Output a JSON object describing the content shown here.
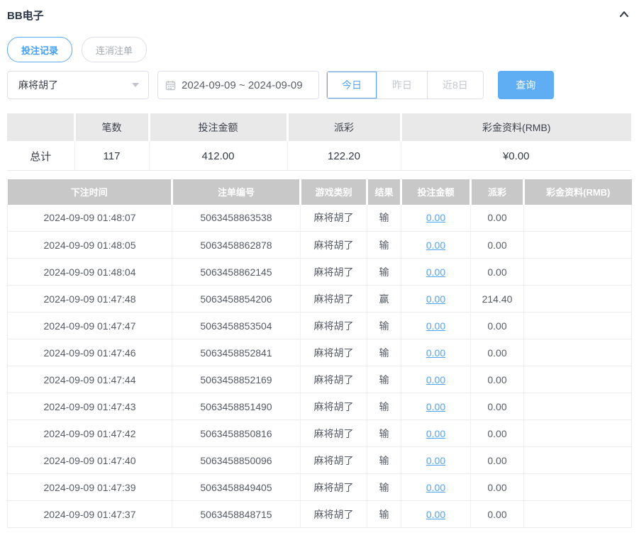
{
  "page": {
    "title": "BB电子"
  },
  "tabs": [
    {
      "label": "投注记录",
      "active": true
    },
    {
      "label": "连消注单",
      "active": false
    }
  ],
  "filters": {
    "game_select_value": "麻将胡了",
    "date_range": "2024-09-09 ~ 2024-09-09",
    "quick_buttons": [
      {
        "label": "今日",
        "active": true
      },
      {
        "label": "昨日",
        "active": false
      },
      {
        "label": "近8日",
        "active": false
      }
    ],
    "query_label": "查询"
  },
  "summary_table": {
    "headers": [
      "",
      "笔数",
      "投注金额",
      "派彩",
      "彩金资料(RMB)"
    ],
    "total_row": {
      "label": "总计",
      "count": "117",
      "bet_amount": "412.00",
      "payout": "122.20",
      "bonus": "¥0.00"
    }
  },
  "records_table": {
    "headers": [
      "下注时间",
      "注单编号",
      "游戏类别",
      "结果",
      "投注金额",
      "派彩",
      "彩金资料(RMB)"
    ],
    "rows": [
      {
        "time": "2024-09-09 01:48:07",
        "bet_no": "5063458863538",
        "game": "麻将胡了",
        "result": "输",
        "bet_amount": "0.00",
        "payout": "0.00",
        "bonus": ""
      },
      {
        "time": "2024-09-09 01:48:05",
        "bet_no": "5063458862878",
        "game": "麻将胡了",
        "result": "输",
        "bet_amount": "0.00",
        "payout": "0.00",
        "bonus": ""
      },
      {
        "time": "2024-09-09 01:48:04",
        "bet_no": "5063458862145",
        "game": "麻将胡了",
        "result": "输",
        "bet_amount": "0.00",
        "payout": "0.00",
        "bonus": ""
      },
      {
        "time": "2024-09-09 01:47:48",
        "bet_no": "5063458854206",
        "game": "麻将胡了",
        "result": "赢",
        "bet_amount": "0.00",
        "payout": "214.40",
        "bonus": ""
      },
      {
        "time": "2024-09-09 01:47:47",
        "bet_no": "5063458853504",
        "game": "麻将胡了",
        "result": "输",
        "bet_amount": "0.00",
        "payout": "0.00",
        "bonus": ""
      },
      {
        "time": "2024-09-09 01:47:46",
        "bet_no": "5063458852841",
        "game": "麻将胡了",
        "result": "输",
        "bet_amount": "0.00",
        "payout": "0.00",
        "bonus": ""
      },
      {
        "time": "2024-09-09 01:47:44",
        "bet_no": "5063458852169",
        "game": "麻将胡了",
        "result": "输",
        "bet_amount": "0.00",
        "payout": "0.00",
        "bonus": ""
      },
      {
        "time": "2024-09-09 01:47:43",
        "bet_no": "5063458851490",
        "game": "麻将胡了",
        "result": "输",
        "bet_amount": "0.00",
        "payout": "0.00",
        "bonus": ""
      },
      {
        "time": "2024-09-09 01:47:42",
        "bet_no": "5063458850816",
        "game": "麻将胡了",
        "result": "输",
        "bet_amount": "0.00",
        "payout": "0.00",
        "bonus": ""
      },
      {
        "time": "2024-09-09 01:47:40",
        "bet_no": "5063458850096",
        "game": "麻将胡了",
        "result": "输",
        "bet_amount": "0.00",
        "payout": "0.00",
        "bonus": ""
      },
      {
        "time": "2024-09-09 01:47:39",
        "bet_no": "5063458849405",
        "game": "麻将胡了",
        "result": "输",
        "bet_amount": "0.00",
        "payout": "0.00",
        "bonus": ""
      },
      {
        "time": "2024-09-09 01:47:37",
        "bet_no": "5063458848715",
        "game": "麻将胡了",
        "result": "输",
        "bet_amount": "0.00",
        "payout": "0.00",
        "bonus": ""
      }
    ]
  },
  "colors": {
    "accent_blue": "#54a3f0",
    "query_button_bg": "#5fadf2",
    "records_header_bg": "#c8c8c8",
    "summary_header_bg": "#e9e9e9",
    "title_text": "#2b3648"
  }
}
